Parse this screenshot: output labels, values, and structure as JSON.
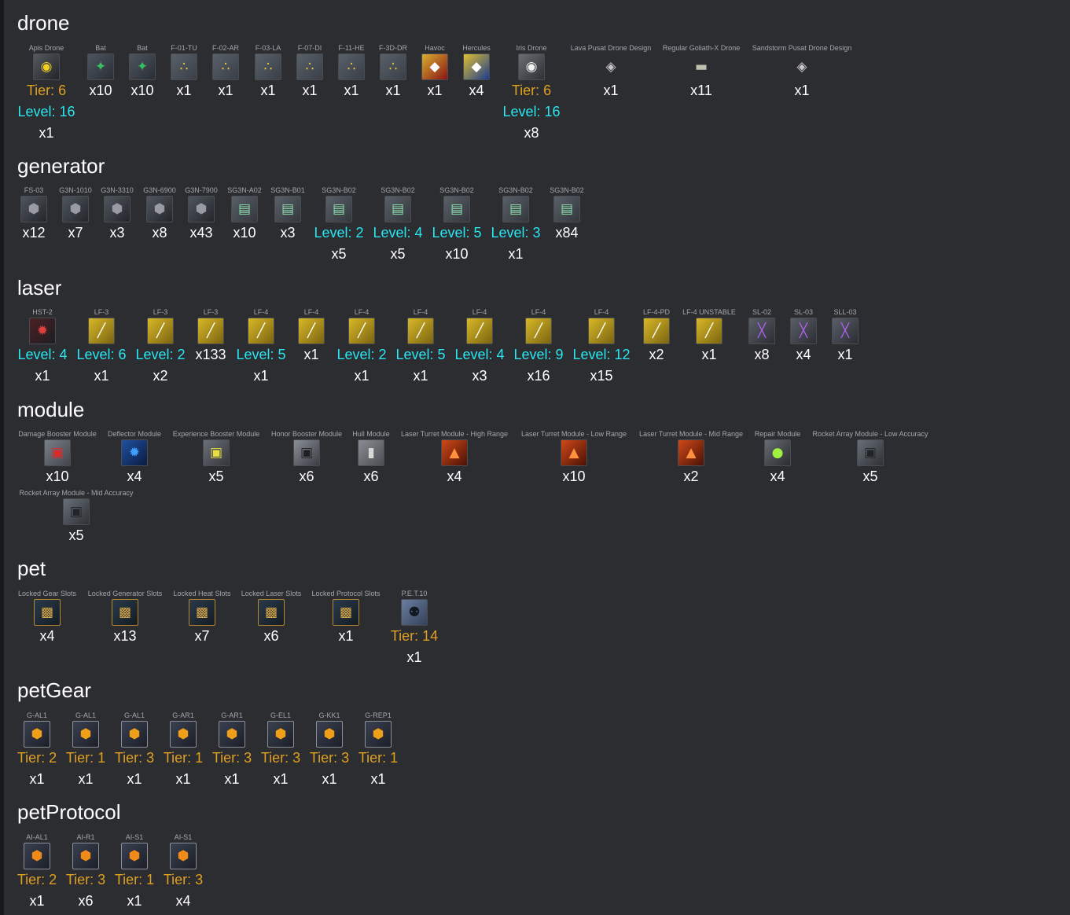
{
  "colors": {
    "background": "#2b2d31",
    "tier": "#e0a020",
    "level": "#2ae6f0",
    "quantity": "#ffffff",
    "item_name": "#a4a6ab"
  },
  "categories": [
    {
      "title": "drone",
      "items": [
        {
          "name": "Apis Drone",
          "icon": "apis-drone-icon",
          "tier": "Tier: 6",
          "level": "Level: 16",
          "qty": "x1"
        },
        {
          "name": "Bat",
          "icon": "bat-drone-icon",
          "qty": "x10"
        },
        {
          "name": "Bat",
          "icon": "bat-drone-icon",
          "qty": "x10"
        },
        {
          "name": "F-01-TU",
          "icon": "drone-formation-icon",
          "qty": "x1"
        },
        {
          "name": "F-02-AR",
          "icon": "drone-formation-icon",
          "qty": "x1"
        },
        {
          "name": "F-03-LA",
          "icon": "drone-formation-icon",
          "qty": "x1"
        },
        {
          "name": "F-07-DI",
          "icon": "drone-formation-icon",
          "qty": "x1"
        },
        {
          "name": "F-11-HE",
          "icon": "drone-formation-icon",
          "qty": "x1"
        },
        {
          "name": "F-3D-DR",
          "icon": "drone-formation-icon",
          "qty": "x1"
        },
        {
          "name": "Havoc",
          "icon": "havoc-design-icon",
          "qty": "x1"
        },
        {
          "name": "Hercules",
          "icon": "hercules-design-icon",
          "qty": "x4"
        },
        {
          "name": "Iris Drone",
          "icon": "iris-drone-icon",
          "tier": "Tier: 6",
          "level": "Level: 16",
          "qty": "x8"
        },
        {
          "name": "Lava Pusat Drone Design",
          "icon": "drone-design-icon",
          "qty": "x1"
        },
        {
          "name": "Regular Goliath-X Drone",
          "icon": "goliath-x-drone-icon",
          "qty": "x11"
        },
        {
          "name": "Sandstorm Pusat Drone Design",
          "icon": "drone-design-icon",
          "qty": "x1"
        }
      ]
    },
    {
      "title": "generator",
      "items": [
        {
          "name": "FS-03",
          "icon": "generator-icon",
          "qty": "x12"
        },
        {
          "name": "G3N-1010",
          "icon": "generator-icon",
          "qty": "x7"
        },
        {
          "name": "G3N-3310",
          "icon": "generator-icon",
          "qty": "x3"
        },
        {
          "name": "G3N-6900",
          "icon": "generator-icon",
          "qty": "x8"
        },
        {
          "name": "G3N-7900",
          "icon": "generator-icon",
          "qty": "x43"
        },
        {
          "name": "SG3N-A02",
          "icon": "shield-generator-icon",
          "qty": "x10"
        },
        {
          "name": "SG3N-B01",
          "icon": "shield-generator-icon",
          "qty": "x3"
        },
        {
          "name": "SG3N-B02",
          "icon": "shield-generator-icon",
          "level": "Level: 2",
          "qty": "x5"
        },
        {
          "name": "SG3N-B02",
          "icon": "shield-generator-icon",
          "level": "Level: 4",
          "qty": "x5"
        },
        {
          "name": "SG3N-B02",
          "icon": "shield-generator-icon",
          "level": "Level: 5",
          "qty": "x10"
        },
        {
          "name": "SG3N-B02",
          "icon": "shield-generator-icon",
          "level": "Level: 3",
          "qty": "x1"
        },
        {
          "name": "SG3N-B02",
          "icon": "shield-generator-icon",
          "qty": "x84"
        }
      ]
    },
    {
      "title": "laser",
      "items": [
        {
          "name": "HST-2",
          "icon": "rocket-launcher-icon",
          "level": "Level: 4",
          "qty": "x1"
        },
        {
          "name": "LF-3",
          "icon": "laser-cannon-icon",
          "level": "Level: 6",
          "qty": "x1"
        },
        {
          "name": "LF-3",
          "icon": "laser-cannon-icon",
          "level": "Level: 2",
          "qty": "x2"
        },
        {
          "name": "LF-3",
          "icon": "laser-cannon-icon",
          "qty": "x133"
        },
        {
          "name": "LF-4",
          "icon": "laser-cannon-icon",
          "level": "Level: 5",
          "qty": "x1"
        },
        {
          "name": "LF-4",
          "icon": "laser-cannon-icon",
          "qty": "x1"
        },
        {
          "name": "LF-4",
          "icon": "laser-cannon-icon",
          "level": "Level: 2",
          "qty": "x1"
        },
        {
          "name": "LF-4",
          "icon": "laser-cannon-icon",
          "level": "Level: 5",
          "qty": "x1"
        },
        {
          "name": "LF-4",
          "icon": "laser-cannon-icon",
          "level": "Level: 4",
          "qty": "x3"
        },
        {
          "name": "LF-4",
          "icon": "laser-cannon-icon",
          "level": "Level: 9",
          "qty": "x16"
        },
        {
          "name": "LF-4",
          "icon": "laser-cannon-icon",
          "level": "Level: 12",
          "qty": "x15"
        },
        {
          "name": "LF-4-PD",
          "icon": "laser-cannon-icon",
          "qty": "x2"
        },
        {
          "name": "LF-4 UNSTABLE",
          "icon": "laser-cannon-icon",
          "qty": "x1"
        },
        {
          "name": "SL-02",
          "icon": "shotgun-laser-icon",
          "qty": "x8"
        },
        {
          "name": "SL-03",
          "icon": "shotgun-laser-icon",
          "qty": "x4"
        },
        {
          "name": "SLL-03",
          "icon": "shotgun-laser-icon",
          "qty": "x1"
        }
      ]
    },
    {
      "title": "module",
      "items": [
        {
          "name": "Damage Booster Module",
          "icon": "damage-module-icon",
          "qty": "x10"
        },
        {
          "name": "Deflector Module",
          "icon": "deflector-module-icon",
          "qty": "x4"
        },
        {
          "name": "Experience Booster Module",
          "icon": "experience-module-icon",
          "qty": "x5"
        },
        {
          "name": "Honor Booster Module",
          "icon": "honor-module-icon",
          "qty": "x6"
        },
        {
          "name": "Hull Module",
          "icon": "hull-module-icon",
          "qty": "x6"
        },
        {
          "name": "Laser Turret Module - High Range",
          "icon": "turret-module-icon",
          "qty": "x4"
        },
        {
          "name": "Laser Turret Module - Low Range",
          "icon": "turret-module-icon",
          "qty": "x10"
        },
        {
          "name": "Laser Turret Module - Mid Range",
          "icon": "turret-module-icon",
          "qty": "x2"
        },
        {
          "name": "Repair Module",
          "icon": "repair-module-icon",
          "qty": "x4"
        },
        {
          "name": "Rocket Array Module - Low Accuracy",
          "icon": "rocket-module-icon",
          "qty": "x5"
        },
        {
          "name": "Rocket Array Module - Mid Accuracy",
          "icon": "rocket-module-icon",
          "qty": "x5"
        }
      ]
    },
    {
      "title": "pet",
      "items": [
        {
          "name": "Locked Gear Slots",
          "icon": "lock-icon",
          "qty": "x4"
        },
        {
          "name": "Locked Generator Slots",
          "icon": "lock-icon",
          "qty": "x13"
        },
        {
          "name": "Locked Heat Slots",
          "icon": "lock-icon",
          "qty": "x7"
        },
        {
          "name": "Locked Laser Slots",
          "icon": "lock-icon",
          "qty": "x6"
        },
        {
          "name": "Locked Protocol Slots",
          "icon": "lock-icon",
          "qty": "x1"
        },
        {
          "name": "P.E.T.10",
          "icon": "pet-robot-icon",
          "tier": "Tier: 14",
          "qty": "x1"
        }
      ]
    },
    {
      "title": "petGear",
      "items": [
        {
          "name": "G-AL1",
          "icon": "pet-gear-icon",
          "tier": "Tier: 2",
          "qty": "x1"
        },
        {
          "name": "G-AL1",
          "icon": "pet-gear-icon",
          "tier": "Tier: 1",
          "qty": "x1"
        },
        {
          "name": "G-AL1",
          "icon": "pet-gear-icon",
          "tier": "Tier: 3",
          "qty": "x1"
        },
        {
          "name": "G-AR1",
          "icon": "pet-gear-icon",
          "tier": "Tier: 1",
          "qty": "x1"
        },
        {
          "name": "G-AR1",
          "icon": "pet-gear-icon",
          "tier": "Tier: 3",
          "qty": "x1"
        },
        {
          "name": "G-EL1",
          "icon": "pet-gear-icon",
          "tier": "Tier: 3",
          "qty": "x1"
        },
        {
          "name": "G-KK1",
          "icon": "pet-gear-icon",
          "tier": "Tier: 3",
          "qty": "x1"
        },
        {
          "name": "G-REP1",
          "icon": "pet-gear-icon",
          "tier": "Tier: 1",
          "qty": "x1"
        }
      ]
    },
    {
      "title": "petProtocol",
      "items": [
        {
          "name": "AI-AL1",
          "icon": "pet-protocol-icon",
          "tier": "Tier: 2",
          "qty": "x1"
        },
        {
          "name": "AI-R1",
          "icon": "pet-protocol-icon",
          "tier": "Tier: 3",
          "qty": "x6"
        },
        {
          "name": "AI-S1",
          "icon": "pet-protocol-icon",
          "tier": "Tier: 1",
          "qty": "x1"
        },
        {
          "name": "AI-S1",
          "icon": "pet-protocol-icon",
          "tier": "Tier: 3",
          "qty": "x4"
        }
      ]
    }
  ]
}
